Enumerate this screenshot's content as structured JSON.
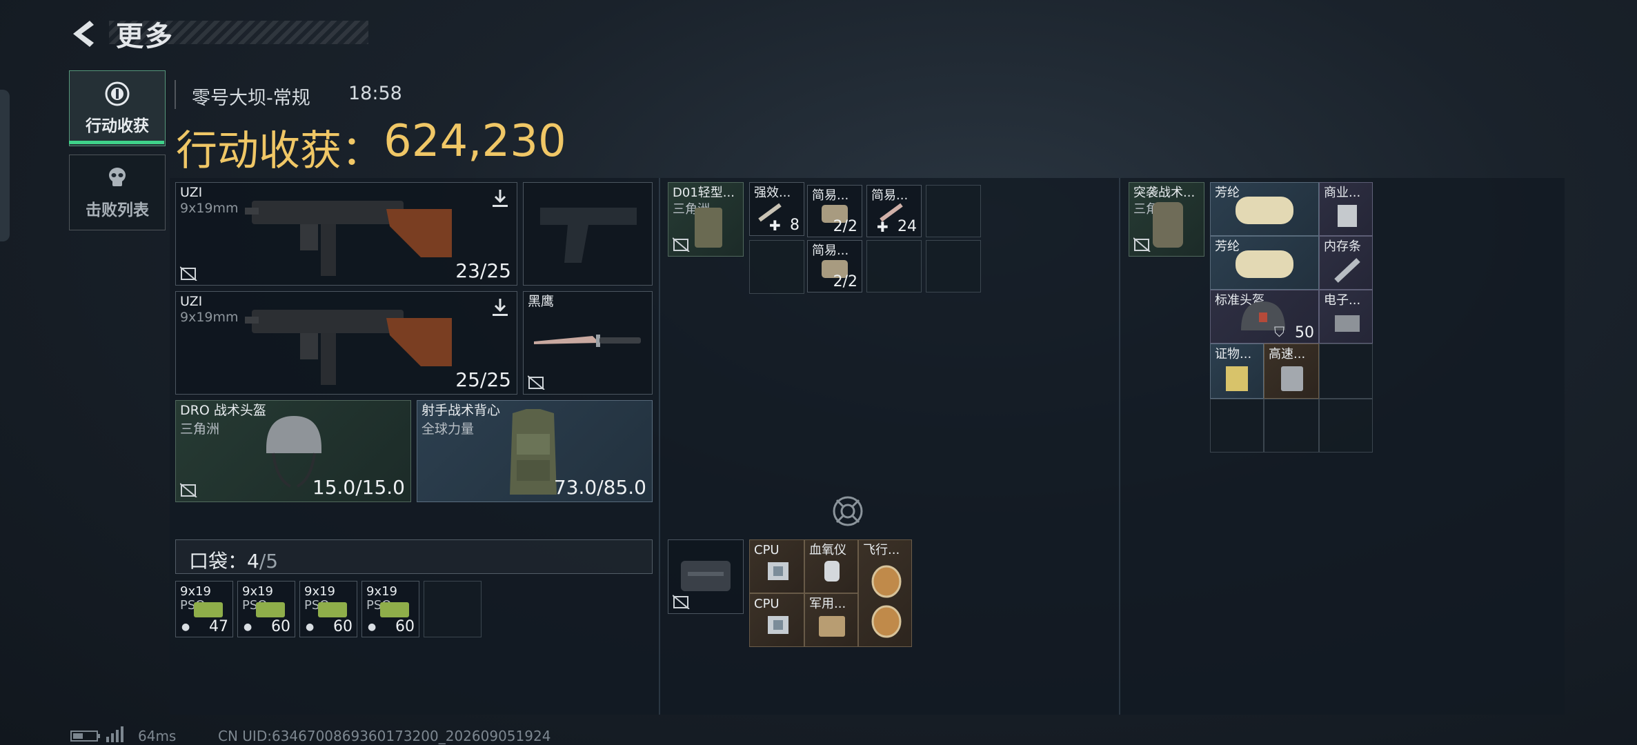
{
  "header": {
    "title": "更多"
  },
  "tabs": [
    {
      "label": "行动收获",
      "icon": "loot-icon",
      "active": true
    },
    {
      "label": "击败列表",
      "icon": "skull-icon",
      "active": false
    }
  ],
  "raid": {
    "map": "零号大坝-常规",
    "time": "18:58",
    "loot_label": "行动收获：",
    "loot_value": "624,230"
  },
  "weapons": [
    {
      "name": "UZI",
      "ammo_type": "9x19mm",
      "ammo": "23/25"
    },
    {
      "name": "UZI",
      "ammo_type": "9x19mm",
      "ammo": "25/25"
    }
  ],
  "melee": {
    "name": "黑鹰"
  },
  "helmet": {
    "name": "DRO 战术头盔",
    "brand": "三角洲",
    "durability": "15.0/15.0"
  },
  "armor": {
    "name": "射手战术背心",
    "brand": "全球力量",
    "durability": "73.0/85.0"
  },
  "pocket": {
    "label": "口袋：",
    "used": "4",
    "max": "/5",
    "items": [
      {
        "name": "9x19",
        "sub": "PSO",
        "count": "47"
      },
      {
        "name": "9x19",
        "sub": "PSO",
        "count": "60"
      },
      {
        "name": "9x19",
        "sub": "PSO",
        "count": "60"
      },
      {
        "name": "9x19",
        "sub": "PSO",
        "count": "60"
      }
    ]
  },
  "chest_rig": {
    "name": "D01轻型...",
    "brand": "三角洲"
  },
  "rig_items": [
    {
      "name": "强效...",
      "count": "8"
    },
    {
      "name": "简易...",
      "count": "2/2"
    },
    {
      "name": "简易...",
      "count": "24"
    },
    {
      "name": "简易...",
      "count": "2/2"
    }
  ],
  "backpack": {
    "name": "突袭战术...",
    "brand": "三角洲"
  },
  "backpack_items": [
    {
      "name": "芳纶"
    },
    {
      "name": "商业..."
    },
    {
      "name": "芳纶"
    },
    {
      "name": "内存条"
    },
    {
      "name": "标准头盔",
      "count": "50"
    },
    {
      "name": "电子..."
    },
    {
      "name": "证物..."
    },
    {
      "name": "高速..."
    }
  ],
  "case_items": [
    {
      "name": "CPU"
    },
    {
      "name": "血氧仪"
    },
    {
      "name": "飞行..."
    },
    {
      "name": "CPU"
    },
    {
      "name": "军用..."
    }
  ],
  "footer": {
    "ping": "64ms",
    "uid": "CN UID:6346700869360173200_202609051924"
  },
  "colors": {
    "accent_gold": "#f0c766",
    "tab_active": "#3fd38a"
  }
}
